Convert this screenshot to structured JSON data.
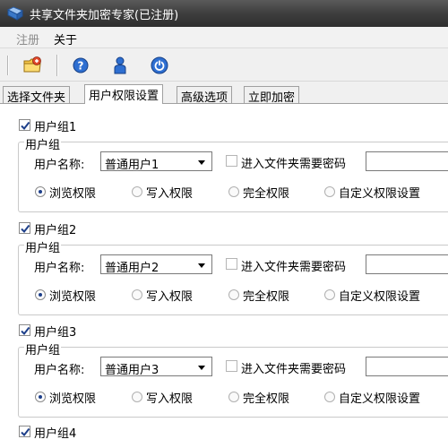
{
  "window": {
    "title": "共享文件夹加密专家(已注册)",
    "icon": "app-folder-icon"
  },
  "menu": {
    "items": [
      {
        "label": "注册",
        "disabled": true
      },
      {
        "label": "关于",
        "disabled": false
      }
    ]
  },
  "toolbar": {
    "buttons": [
      {
        "icon": "folder-add-icon"
      },
      {
        "icon": "help-icon"
      },
      {
        "icon": "user-icon"
      },
      {
        "icon": "power-icon"
      }
    ]
  },
  "tabs": [
    {
      "label": "选择文件夹",
      "active": false
    },
    {
      "label": "用户权限设置",
      "active": true
    },
    {
      "label": "高级选项",
      "active": false
    },
    {
      "label": "立即加密",
      "active": false
    }
  ],
  "groups": [
    {
      "enabled": true,
      "title": "用户组1",
      "fieldset": "用户组",
      "user_label": "用户名称:",
      "user_value": "普通用户1",
      "need_password": false,
      "password_label": "进入文件夹需要密码",
      "permissions": [
        "浏览权限",
        "写入权限",
        "完全权限",
        "自定义权限设置"
      ],
      "selected": 0
    },
    {
      "enabled": true,
      "title": "用户组2",
      "fieldset": "用户组",
      "user_label": "用户名称:",
      "user_value": "普通用户2",
      "need_password": false,
      "password_label": "进入文件夹需要密码",
      "permissions": [
        "浏览权限",
        "写入权限",
        "完全权限",
        "自定义权限设置"
      ],
      "selected": 0
    },
    {
      "enabled": true,
      "title": "用户组3",
      "fieldset": "用户组",
      "user_label": "用户名称:",
      "user_value": "普通用户3",
      "need_password": false,
      "password_label": "进入文件夹需要密码",
      "permissions": [
        "浏览权限",
        "写入权限",
        "完全权限",
        "自定义权限设置"
      ],
      "selected": 0
    },
    {
      "enabled": true,
      "title": "用户组4"
    }
  ],
  "colors": {
    "titlebar": "#3e3e3e",
    "radio_dot": "#1d3f8a",
    "checkmark": "#1d3f8a"
  }
}
